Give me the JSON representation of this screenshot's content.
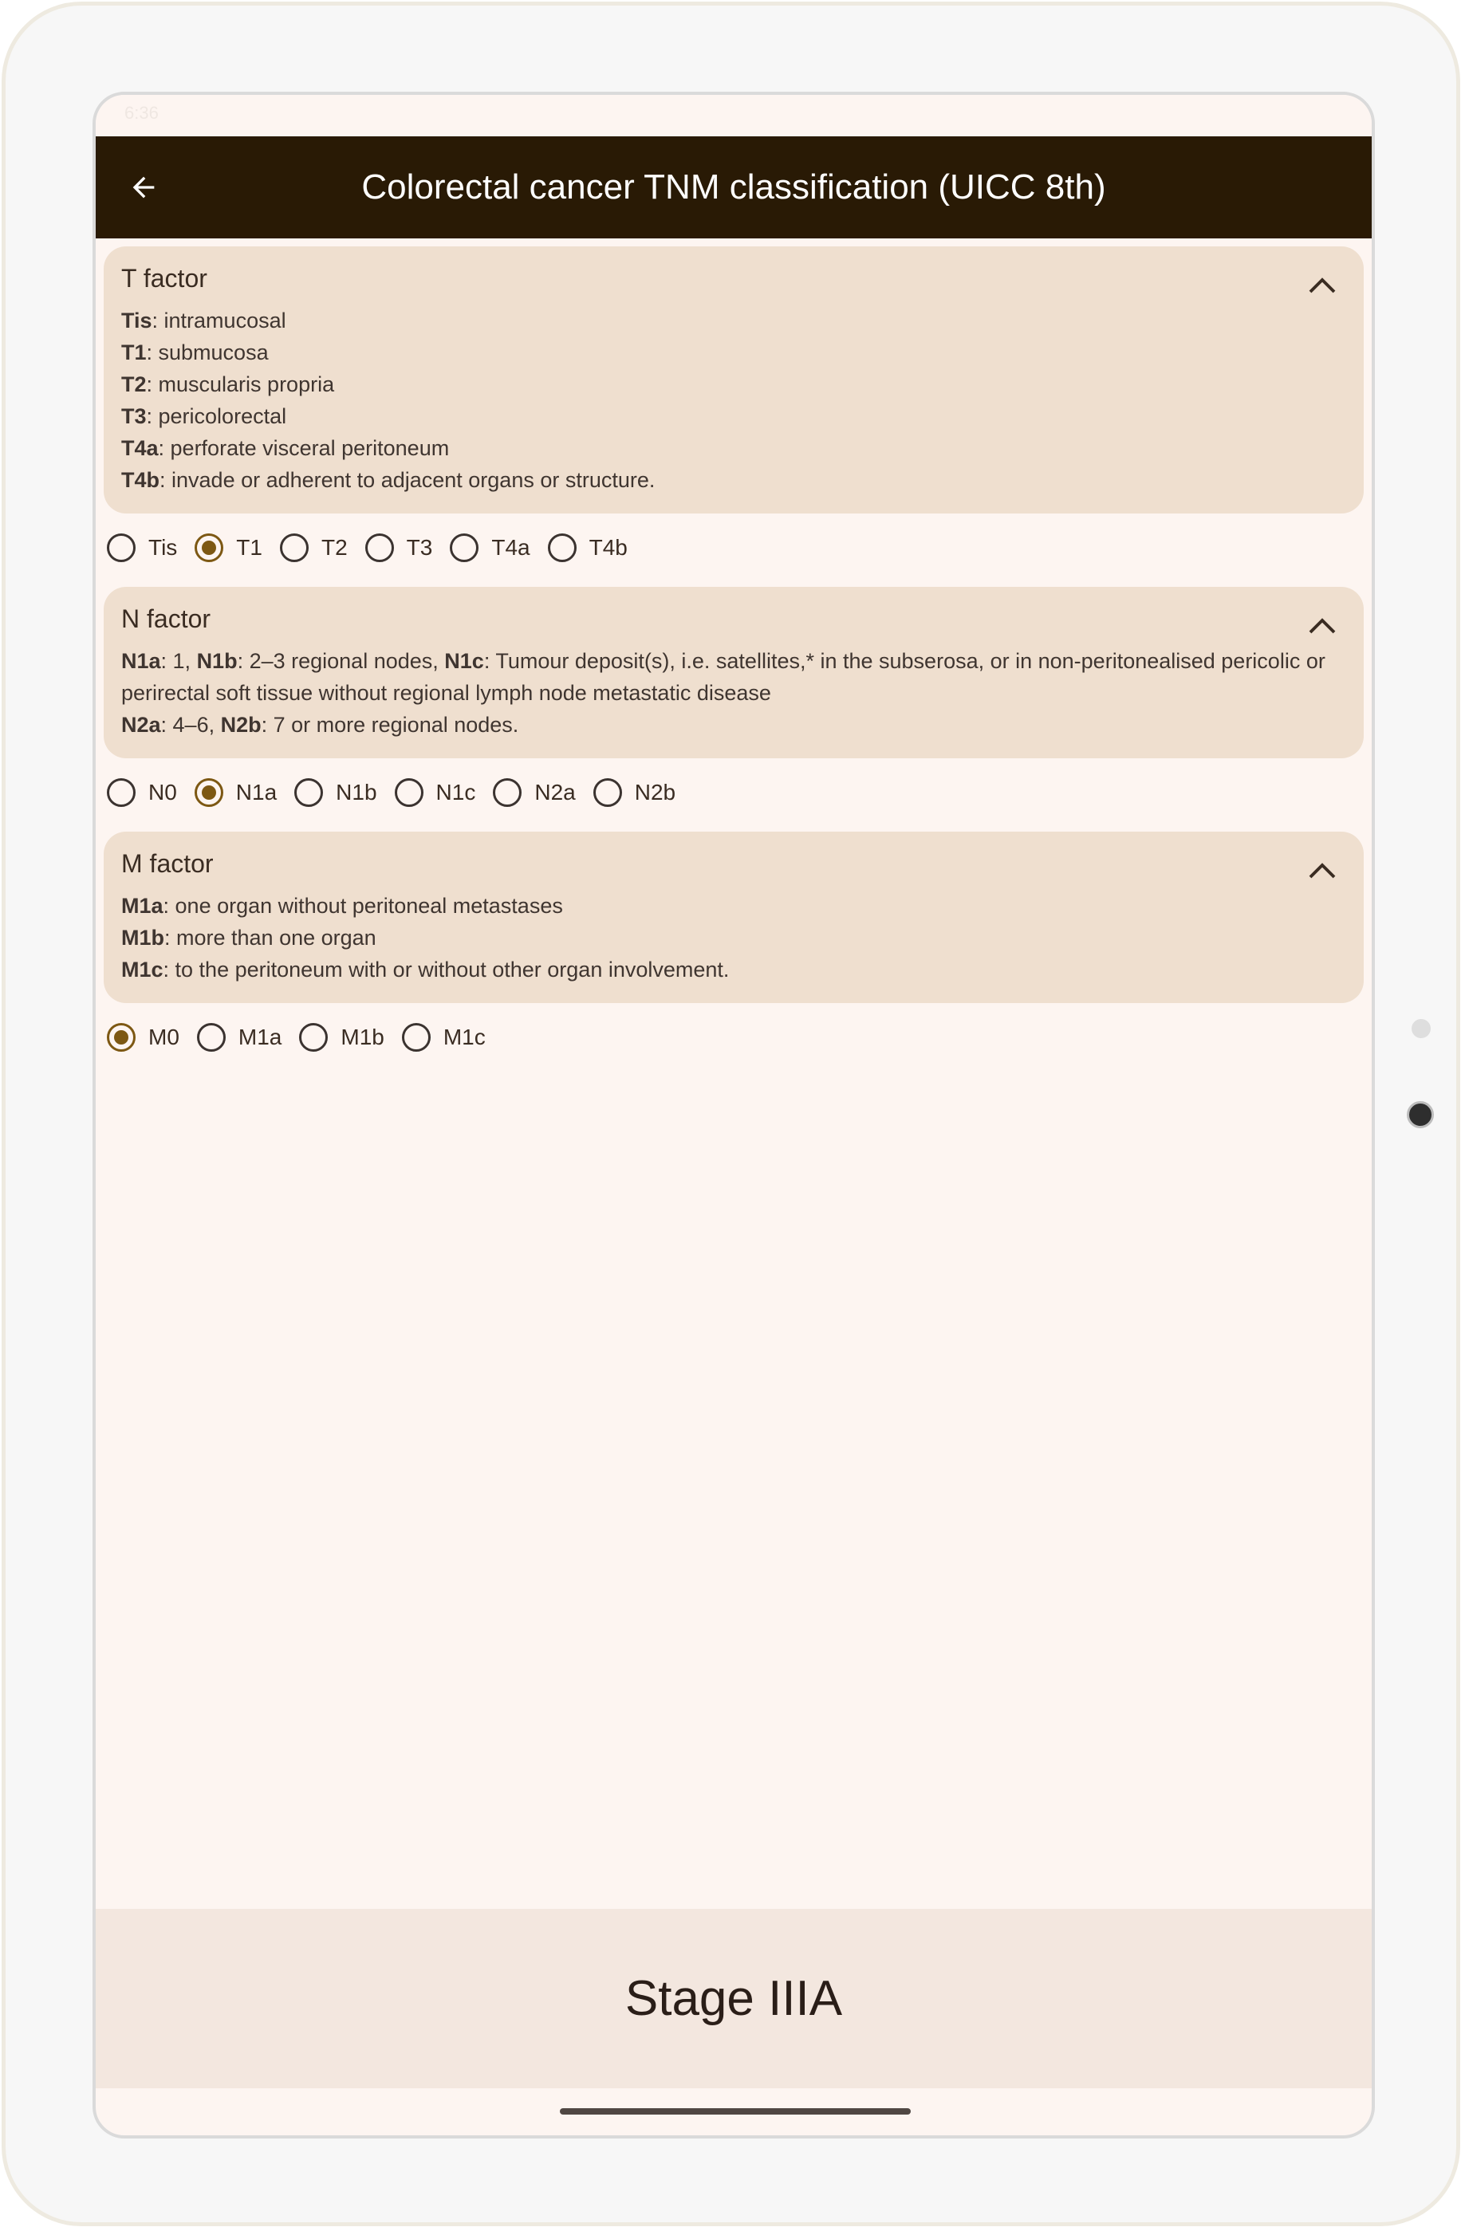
{
  "app": {
    "status_time": "6:36",
    "title": "Colorectal cancer TNM classification (UICC 8th)"
  },
  "t_factor": {
    "title": "T factor",
    "desc": [
      {
        "code": "Tis",
        "text": ": intramucosal"
      },
      {
        "code": "T1",
        "text": ": submucosa"
      },
      {
        "code": "T2",
        "text": ": muscularis propria"
      },
      {
        "code": "T3",
        "text": ": pericolorectal"
      },
      {
        "code": "T4a",
        "text": ": perforate visceral peritoneum"
      },
      {
        "code": "T4b",
        "text": ": invade or adherent to adjacent organs or structure."
      }
    ],
    "options": [
      "Tis",
      "T1",
      "T2",
      "T3",
      "T4a",
      "T4b"
    ],
    "selected": "T1"
  },
  "n_factor": {
    "title": "N factor",
    "line1": {
      "a_code": "N1a",
      "a_text": ": 1, ",
      "b_code": "N1b",
      "b_text": ": 2–3 regional nodes, ",
      "c_code": "N1c",
      "c_text": ": Tumour deposit(s), i.e. satellites,* in the subserosa, or in non-peritonealised pericolic or perirectal soft tissue without regional lymph node metastatic disease"
    },
    "line2": {
      "a_code": "N2a",
      "a_text": ": 4–6, ",
      "b_code": "N2b",
      "b_text": ": 7 or more regional nodes."
    },
    "options": [
      "N0",
      "N1a",
      "N1b",
      "N1c",
      "N2a",
      "N2b"
    ],
    "selected": "N1a"
  },
  "m_factor": {
    "title": "M factor",
    "desc": [
      {
        "code": "M1a",
        "text": ": one organ without peritoneal metastases"
      },
      {
        "code": "M1b",
        "text": ": more than one organ"
      },
      {
        "code": "M1c",
        "text": ": to the peritoneum with or without other organ involvement."
      }
    ],
    "options": [
      "M0",
      "M1a",
      "M1b",
      "M1c"
    ],
    "selected": "M0"
  },
  "result": {
    "stage": "Stage IIIA"
  },
  "colors": {
    "appbar": "#291a05",
    "card": "#efdfcf",
    "accent": "#7d5813",
    "background": "#fdf5f1",
    "stagebar": "#f3e7df"
  }
}
